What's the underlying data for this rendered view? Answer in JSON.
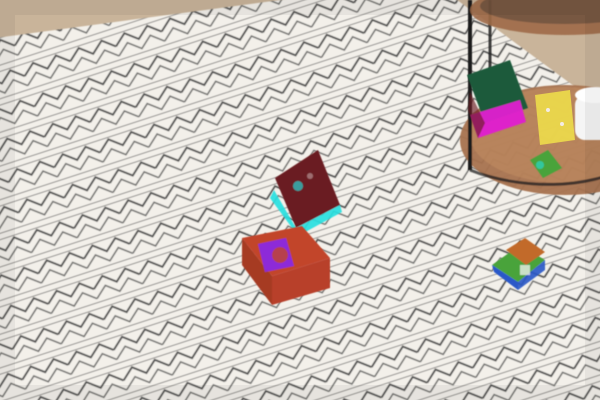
{
  "scene": {
    "colors": {
      "floor": "#c9b49a",
      "rug_base": "#f3f0ea",
      "rug_pattern": "#3a3a3a",
      "table_wood": "#a8734f",
      "table_metal": "#1f1f1f",
      "block_maroon": "#6b1f22",
      "block_cyan": "#22e0e0",
      "block_orange": "#c2452c",
      "block_purple": "#8a2be2",
      "book_green": "#1f5a3a",
      "book_magenta": "#e020d0",
      "house_green": "#4aa33a",
      "house_blue": "#2a58c8",
      "house_roof": "#c26a2a",
      "mug_white": "#f5f5f5",
      "tray_yellow": "#f1e24a"
    },
    "objects": [
      {
        "name": "rug",
        "kind": "patterned-rug"
      },
      {
        "name": "side-table",
        "kind": "round-wood-side-table"
      },
      {
        "name": "block-maroon-cyan",
        "kind": "toy-block"
      },
      {
        "name": "block-orange-purple",
        "kind": "toy-block"
      },
      {
        "name": "book-green-magenta",
        "kind": "book"
      },
      {
        "name": "toy-house-green-blue",
        "kind": "toy-house"
      },
      {
        "name": "small-toy-green",
        "kind": "small-toy"
      },
      {
        "name": "mug",
        "kind": "mug"
      }
    ]
  }
}
